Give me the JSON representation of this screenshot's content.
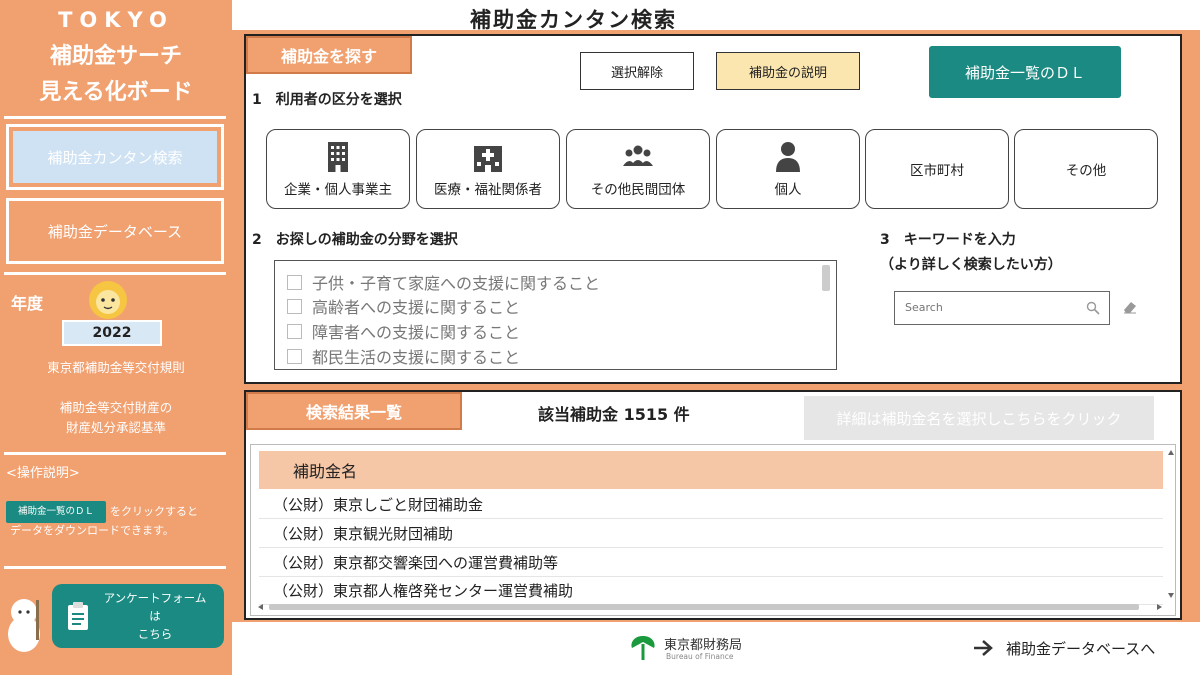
{
  "sidebar": {
    "logo_line1": "TOKYO",
    "logo_line2": "補助金サーチ",
    "logo_line3": "見える化ボード",
    "simple_search_label": "補助金カンタン検索",
    "database_label": "補助金データベース",
    "year_label": "年度",
    "year_value": "2022",
    "rules_link": "東京都補助金等交付規則",
    "property_link_line1": "補助金等交付財産の",
    "property_link_line2": "財産処分承認基準",
    "operation_title": "<操作説明>",
    "operation_chip": "補助金一覧のＤＬ",
    "operation_text1": "をクリックすると",
    "operation_text2": "データをダウンロードできます。",
    "survey_line1": "アンケートフォームは",
    "survey_line2": "こちら"
  },
  "header": {
    "title": "補助金カンタン検索"
  },
  "search_panel": {
    "tab_label": "補助金を探す",
    "clear_button": "選択解除",
    "explain_button": "補助金の説明",
    "download_button": "補助金一覧のＤＬ",
    "step1_label": "1　利用者の区分を選択",
    "user_types": [
      {
        "label": "企業・個人事業主",
        "icon": "building-icon"
      },
      {
        "label": "医療・福祉関係者",
        "icon": "hospital-icon"
      },
      {
        "label": "その他民間団体",
        "icon": "group-icon"
      },
      {
        "label": "個人",
        "icon": "person-icon"
      },
      {
        "label": "区市町村",
        "icon": ""
      },
      {
        "label": "その他",
        "icon": ""
      }
    ],
    "step2_label": "2　お探しの補助金の分野を選択",
    "fields": [
      "子供・子育て家庭への支援に関すること",
      "高齢者への支援に関すること",
      "障害者への支援に関すること",
      "都民生活の支援に関すること"
    ],
    "step3_label": "3　キーワードを入力",
    "step3_sub": "（より詳しく検索したい方）",
    "search_placeholder": "Search"
  },
  "results_panel": {
    "tab_label": "検索結果一覧",
    "count_text": "該当補助金 1515 件",
    "detail_button": "詳細は補助金名を選択しこちらをクリック",
    "table_header": "補助金名",
    "rows": [
      "（公財）東京しごと財団補助金",
      "（公財）東京観光財団補助",
      "（公財）東京都交響楽団への運営費補助等",
      "（公財）東京都人権啓発センター運営費補助"
    ]
  },
  "footer": {
    "bureau_name": "東京都財務局",
    "bureau_sub": "Bureau of Finance",
    "database_link": "補助金データベースへ"
  },
  "colors": {
    "accent_orange": "#f1a070",
    "teal": "#1b8a82",
    "explain_yellow": "#fbe6b0",
    "table_header": "#f6c7a6",
    "logo_green": "#1a9a3c"
  }
}
